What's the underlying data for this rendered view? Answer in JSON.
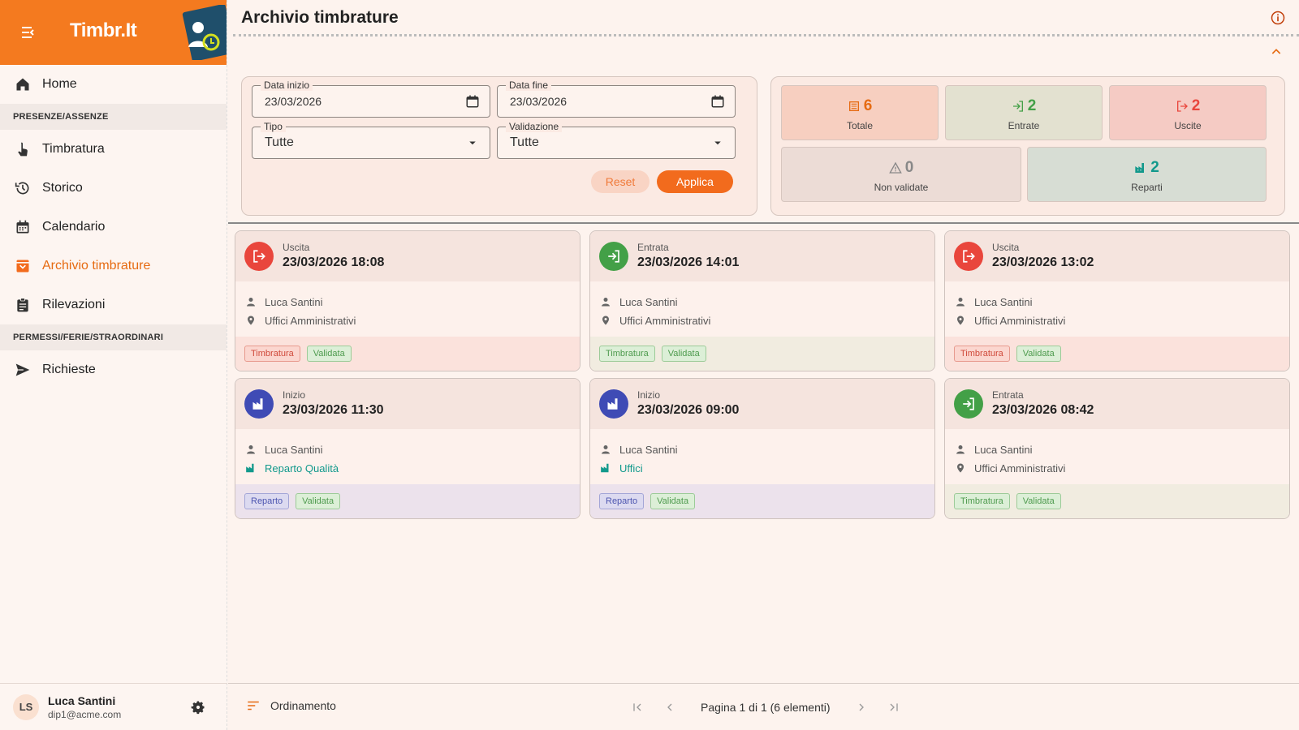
{
  "app": {
    "name": "Timbr.It"
  },
  "page": {
    "title": "Archivio timbrature"
  },
  "sidebar": {
    "items": [
      {
        "label": "Home",
        "icon": "home-icon"
      },
      {
        "section": "PRESENZE/ASSENZE"
      },
      {
        "label": "Timbratura",
        "icon": "touch-icon"
      },
      {
        "label": "Storico",
        "icon": "history-icon"
      },
      {
        "label": "Calendario",
        "icon": "calendar-icon"
      },
      {
        "label": "Archivio timbrature",
        "icon": "archive-icon",
        "active": true
      },
      {
        "label": "Rilevazioni",
        "icon": "clipboard-icon"
      },
      {
        "section": "PERMESSI/FERIE/STRAORDINARI"
      },
      {
        "label": "Richieste",
        "icon": "send-icon"
      }
    ],
    "home": "Home",
    "section1": "PRESENZE/ASSENZE",
    "timbratura": "Timbratura",
    "storico": "Storico",
    "calendario": "Calendario",
    "archivio": "Archivio timbrature",
    "rilevazioni": "Rilevazioni",
    "section2": "PERMESSI/FERIE/STRAORDINARI",
    "richieste": "Richieste"
  },
  "user": {
    "initials": "LS",
    "name": "Luca Santini",
    "email": "dip1@acme.com"
  },
  "filters": {
    "start_label": "Data inizio",
    "start_value": "23/03/2026",
    "end_label": "Data fine",
    "end_value": "23/03/2026",
    "type_label": "Tipo",
    "type_value": "Tutte",
    "validation_label": "Validazione",
    "validation_value": "Tutte",
    "reset": "Reset",
    "apply": "Applica"
  },
  "stats": {
    "total": {
      "value": "6",
      "label": "Totale"
    },
    "entries": {
      "value": "2",
      "label": "Entrate"
    },
    "exits": {
      "value": "2",
      "label": "Uscite"
    },
    "not_validated": {
      "value": "0",
      "label": "Non validate"
    },
    "departments": {
      "value": "2",
      "label": "Reparti"
    }
  },
  "cards": [
    {
      "type": "Uscita",
      "datetime": "23/03/2026 18:08",
      "person": "Luca Santini",
      "place": "Uffici Amministrativi",
      "tags": [
        "Timbratura",
        "Validata"
      ]
    },
    {
      "type": "Entrata",
      "datetime": "23/03/2026 14:01",
      "person": "Luca Santini",
      "place": "Uffici Amministrativi",
      "tags": [
        "Timbratura",
        "Validata"
      ]
    },
    {
      "type": "Uscita",
      "datetime": "23/03/2026 13:02",
      "person": "Luca Santini",
      "place": "Uffici Amministrativi",
      "tags": [
        "Timbratura",
        "Validata"
      ]
    },
    {
      "type": "Inizio",
      "datetime": "23/03/2026 11:30",
      "person": "Luca Santini",
      "place": "Reparto Qualità",
      "tags": [
        "Reparto",
        "Validata"
      ]
    },
    {
      "type": "Inizio",
      "datetime": "23/03/2026 09:00",
      "person": "Luca Santini",
      "place": "Uffici",
      "tags": [
        "Reparto",
        "Validata"
      ]
    },
    {
      "type": "Entrata",
      "datetime": "23/03/2026 08:42",
      "person": "Luca Santini",
      "place": "Uffici Amministrativi",
      "tags": [
        "Timbratura",
        "Validata"
      ]
    }
  ],
  "footer": {
    "sort_label": "Ordinamento",
    "pagination": "Pagina 1 di 1 (6 elementi)"
  },
  "colors": {
    "brand": "#f47a1f",
    "exit": "#e9463c",
    "entry": "#43a047",
    "department": "#3f4bb5",
    "teal": "#12998c"
  }
}
